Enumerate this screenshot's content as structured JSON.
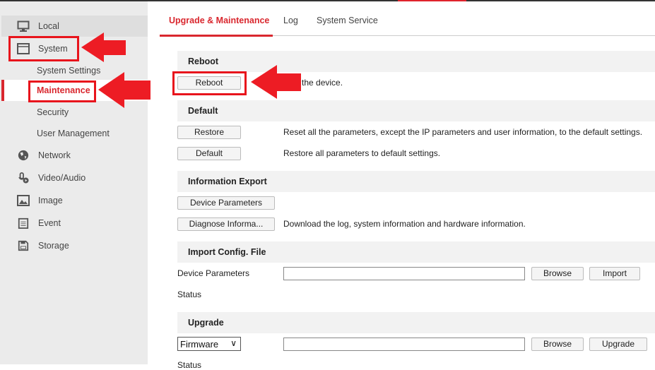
{
  "sidebar": {
    "items": [
      {
        "label": "Local",
        "icon": "monitor-icon"
      },
      {
        "label": "System",
        "icon": "window-icon"
      },
      {
        "label": "System Settings"
      },
      {
        "label": "Maintenance"
      },
      {
        "label": "Security"
      },
      {
        "label": "User Management"
      },
      {
        "label": "Network",
        "icon": "globe-icon"
      },
      {
        "label": "Video/Audio",
        "icon": "microphone-play-icon"
      },
      {
        "label": "Image",
        "icon": "image-icon"
      },
      {
        "label": "Event",
        "icon": "notepad-icon"
      },
      {
        "label": "Storage",
        "icon": "floppy-disk-icon"
      }
    ]
  },
  "tabs": [
    {
      "label": "Upgrade & Maintenance",
      "active": true
    },
    {
      "label": "Log"
    },
    {
      "label": "System Service"
    }
  ],
  "reboot": {
    "title": "Reboot",
    "button": "Reboot",
    "desc": "Reboot the device."
  },
  "default": {
    "title": "Default",
    "restore_button": "Restore",
    "restore_desc": "Reset all the parameters, except the IP parameters and user information, to the default settings.",
    "default_button": "Default",
    "default_desc": "Restore all parameters to default settings."
  },
  "export": {
    "title": "Information Export",
    "device_button": "Device Parameters",
    "diagnose_button": "Diagnose Informa...",
    "diagnose_desc": "Download the log, system information and hardware information."
  },
  "import": {
    "title": "Import Config. File",
    "label": "Device Parameters",
    "file_value": "",
    "browse": "Browse",
    "import": "Import",
    "status": "Status"
  },
  "upgrade": {
    "title": "Upgrade",
    "select_value": "Firmware",
    "file_value": "",
    "browse": "Browse",
    "upgrade": "Upgrade",
    "status": "Status"
  },
  "colors": {
    "accent": "#d9272e",
    "annotation": "#e8141c"
  }
}
